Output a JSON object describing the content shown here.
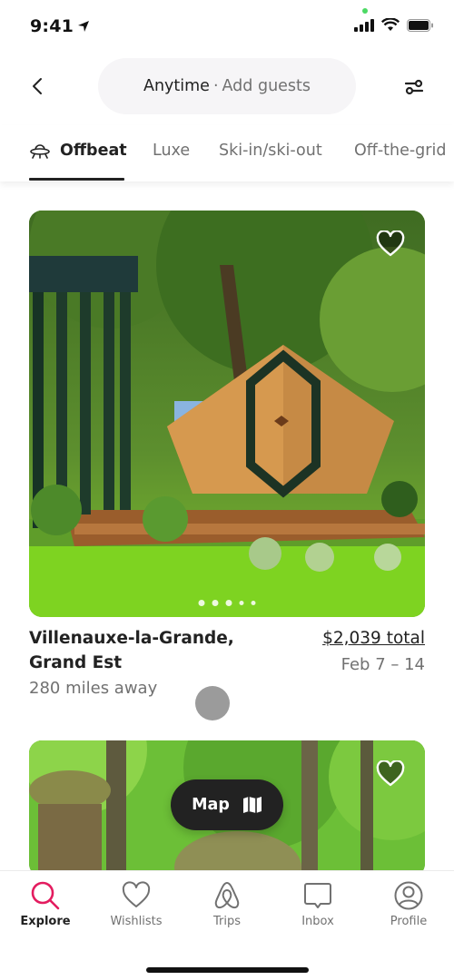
{
  "status_bar": {
    "time": "9:41"
  },
  "header": {
    "back_icon": "chevron-left-icon",
    "search_when": "Anytime",
    "search_separator": "·",
    "search_who": "Add guests",
    "filter_icon": "sliders-icon"
  },
  "tabs": [
    {
      "label": "Offbeat",
      "icon": "ufo-icon",
      "active": true
    },
    {
      "label": "Luxe",
      "active": false
    },
    {
      "label": "Ski-in/ski-out",
      "active": false
    },
    {
      "label": "Off-the-grid",
      "active": false
    }
  ],
  "listings": [
    {
      "title": "Villenauxe-la-Grande, Grand Est",
      "title_line1": "Villenauxe-la-Grande,",
      "title_line2": "Grand Est",
      "distance": "280 miles away",
      "price": "$2,039 total",
      "dates": "Feb 7 – 14",
      "photo_count_dots": 5,
      "active_photo": 1,
      "photo_description": "Wooden geometric cabin with deck in a green garden"
    },
    {
      "photo_description": "Thatched treehouse in green forest"
    }
  ],
  "map_button": {
    "label": "Map",
    "icon": "map-icon"
  },
  "bottom_nav": [
    {
      "label": "Explore",
      "icon": "search-icon",
      "active": true
    },
    {
      "label": "Wishlists",
      "icon": "heart-icon",
      "active": false
    },
    {
      "label": "Trips",
      "icon": "airbnb-logo-icon",
      "active": false
    },
    {
      "label": "Inbox",
      "icon": "message-icon",
      "active": false
    },
    {
      "label": "Profile",
      "icon": "profile-icon",
      "active": false
    }
  ],
  "colors": {
    "accent": "#e31c5f",
    "text_primary": "#222222",
    "text_secondary": "#717171"
  }
}
